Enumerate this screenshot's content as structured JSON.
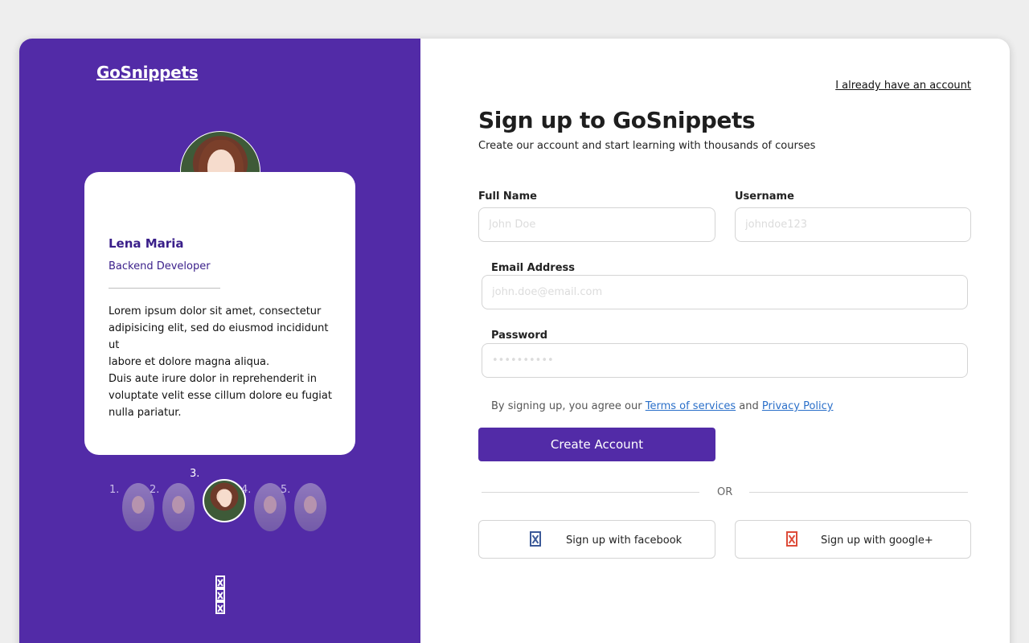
{
  "brand": "GoSnippets",
  "testimonial": {
    "name": "Lena Maria",
    "role": "Backend Developer",
    "text_lines": [
      "Lorem ipsum dolor sit amet, consectetur",
      "adipisicing elit, sed do eiusmod incididunt ut",
      "labore et dolore magna aliqua.",
      "Duis aute irure dolor in reprehenderit in",
      "voluptate velit esse cillum dolore eu fugiat",
      "nulla pariatur."
    ],
    "pager": [
      "1.",
      "2.",
      "3.",
      "4.",
      "5."
    ],
    "active_index": 3
  },
  "header": {
    "have_account": "I already have an account"
  },
  "form": {
    "title": "Sign up to GoSnippets",
    "subtitle": "Create our account and start learning with thousands of courses",
    "full_name_label": "Full Name",
    "full_name_placeholder": "John Doe",
    "username_label": "Username",
    "username_placeholder": "johndoe123",
    "email_label": "Email Address",
    "email_placeholder": "john.doe@email.com",
    "password_label": "Password",
    "password_placeholder": "••••••••••",
    "terms_prefix": "By signing up, you agree our ",
    "terms_link": "Terms of services",
    "terms_and": " and ",
    "privacy_link": "Privacy Policy",
    "create_button": "Create Account",
    "or_text": "OR",
    "facebook_button": "Sign up with facebook",
    "google_button": "Sign up with google+"
  },
  "colors": {
    "brand_purple": "#522ba7",
    "link_blue": "#2a6fc9",
    "facebook_blue": "#3b5998",
    "google_red": "#dd4b39"
  },
  "icons": {
    "pager_broken_images": [
      "broken-image-icon",
      "broken-image-icon",
      "broken-image-icon"
    ],
    "facebook": "broken-image-icon",
    "google": "broken-image-icon"
  }
}
